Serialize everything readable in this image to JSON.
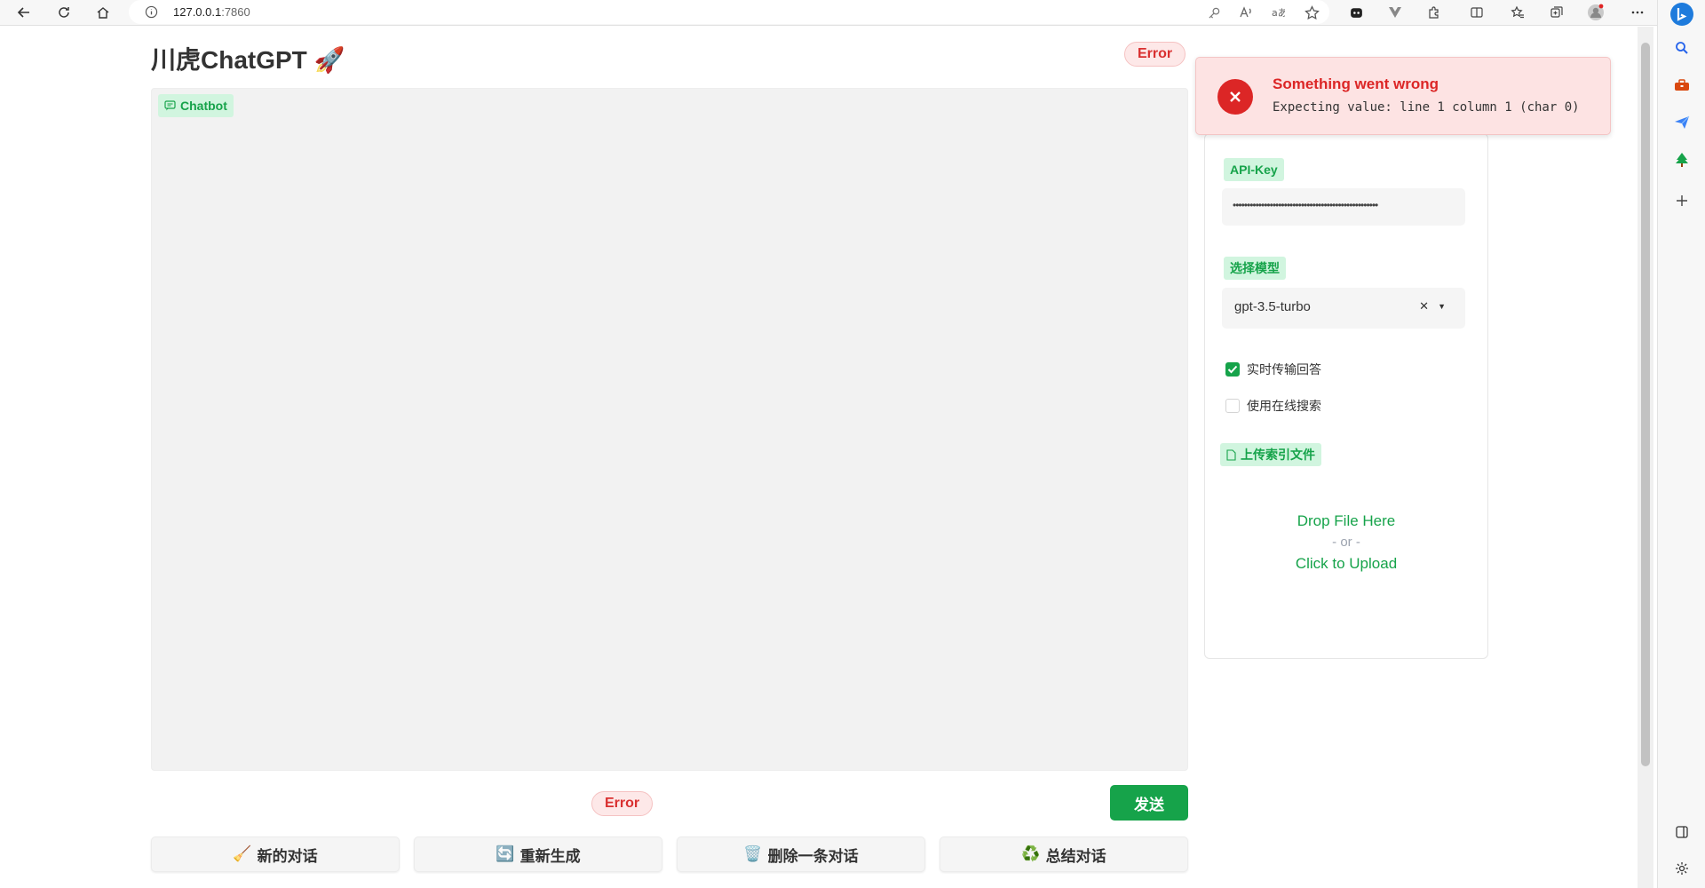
{
  "browser": {
    "url_host": "127.0.0.1",
    "url_port": ":7860"
  },
  "app": {
    "title": "川虎ChatGPT",
    "title_emoji": "🚀",
    "status_top": "Error",
    "status_input": "Error"
  },
  "chatbot": {
    "label": "Chatbot"
  },
  "input": {
    "send_label": "发送"
  },
  "actions": [
    {
      "emoji": "🧹",
      "label": "新的对话"
    },
    {
      "emoji": "🔄",
      "label": "重新生成"
    },
    {
      "emoji": "🗑️",
      "label": "删除一条对话"
    },
    {
      "emoji": "♻️",
      "label": "总结对话"
    }
  ],
  "settings": {
    "api_key_label": "API-Key",
    "api_key_value": "•••••••••••••••••••••••••••••••••••••••••••••••••••",
    "model_label": "选择模型",
    "model_value": "gpt-3.5-turbo",
    "stream_label": "实时传输回答",
    "stream_checked": true,
    "search_label": "使用在线搜索",
    "search_checked": false,
    "upload_label": "上传索引文件",
    "drop_text": "Drop File Here",
    "or_text": "- or -",
    "click_text": "Click to Upload"
  },
  "toast": {
    "title": "Something went wrong",
    "message": "Expecting value: line 1 column 1 (char 0)"
  },
  "colors": {
    "accent": "#16a34a",
    "error": "#dc2626",
    "error_bg": "#fde3e3"
  }
}
